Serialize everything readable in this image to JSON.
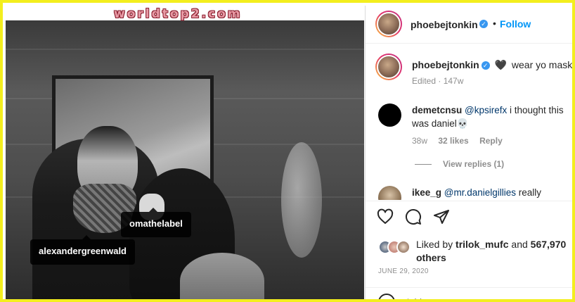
{
  "watermark": "worldtop2.com",
  "photo": {
    "tags": [
      "omathelabel",
      "alexandergreenwald"
    ]
  },
  "post_header": {
    "username": "phoebejtonkin",
    "verified_glyph": "✓",
    "separator": "•",
    "follow_label": "Follow"
  },
  "caption": {
    "username": "phoebejtonkin",
    "heart_glyph": "🖤",
    "text": "wear yo masks!",
    "meta": "Edited · 147w"
  },
  "comments": [
    {
      "username": "demetcnsu",
      "mention": "@kpsirefx",
      "text": " i thought this was daniel",
      "emoji": "💀",
      "age": "38w",
      "likes": "32 likes",
      "reply_label": "Reply",
      "view_replies": "View replies (1)"
    },
    {
      "username": "ikee_g",
      "mention": "@mr.danielgillies",
      "text": " really"
    }
  ],
  "actions": {
    "like_icon": "heart-outline-icon",
    "comment_icon": "comment-bubble-icon",
    "share_icon": "paper-plane-icon"
  },
  "likes": {
    "prefix": "Liked by ",
    "user": "trilok_mufc",
    "middle": " and ",
    "count": "567,970",
    "suffix": " others"
  },
  "date": "JUNE 29, 2020",
  "add_comment": {
    "placeholder": "Add a comment..."
  },
  "colors": {
    "frame_border": "#f3ee1e",
    "link_blue": "#0095f6",
    "mention_blue": "#00376b",
    "verified_blue": "#3897f0",
    "muted": "#8e8e8e"
  }
}
